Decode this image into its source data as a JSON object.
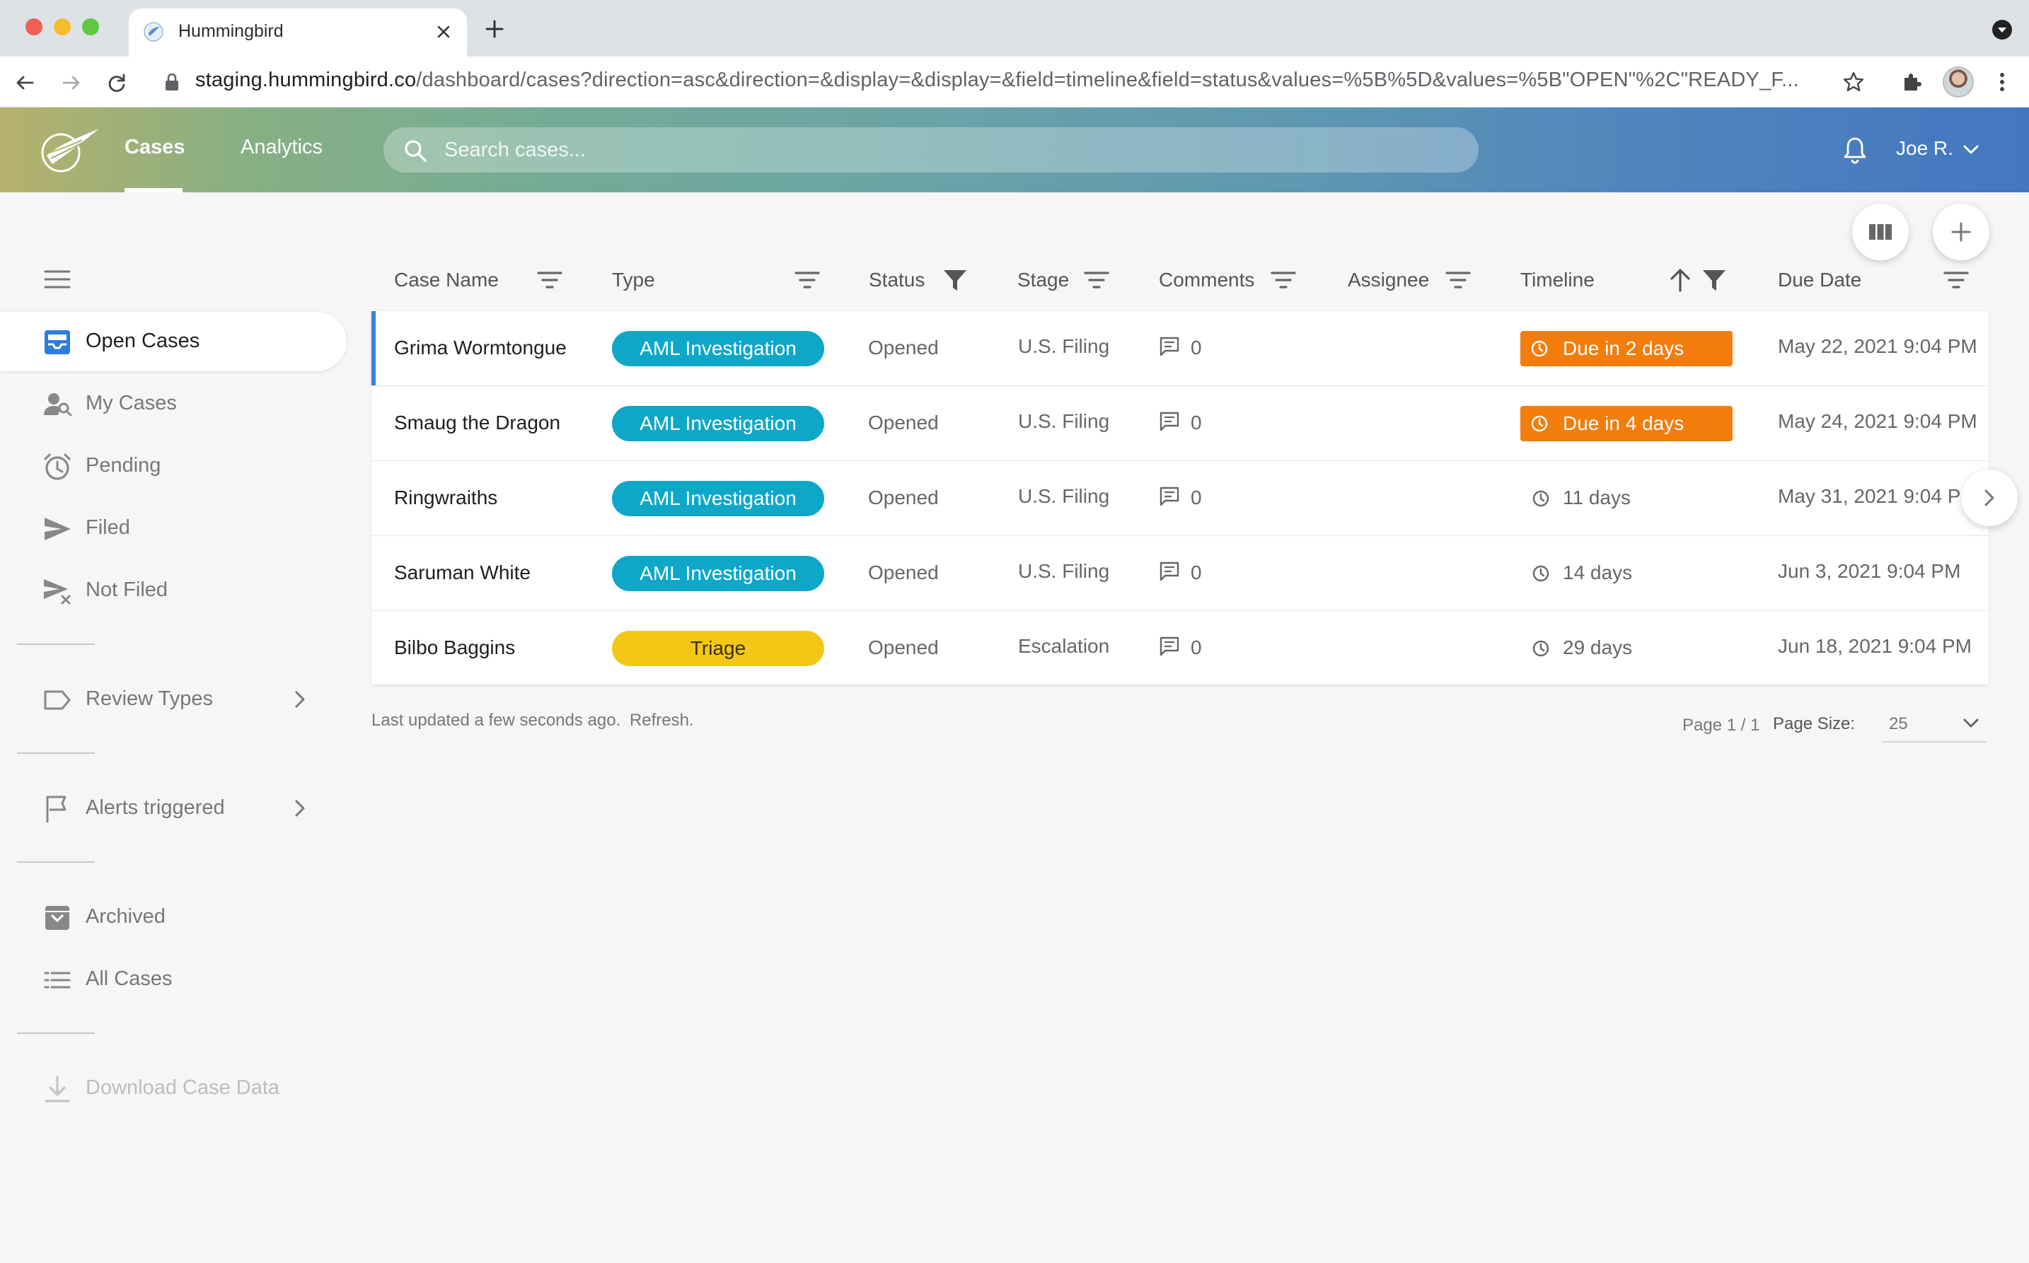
{
  "browser": {
    "tab_title": "Hummingbird",
    "url_host": "staging.hummingbird.co",
    "url_path": "/dashboard/cases?direction=asc&direction=&display=&display=&field=timeline&field=status&values=%5B%5D&values=%5B\"OPEN\"%2C\"READY_F..."
  },
  "header": {
    "nav_cases": "Cases",
    "nav_analytics": "Analytics",
    "search_placeholder": "Search cases...",
    "user_name": "Joe R.",
    "gradient_start": "#b6b16c",
    "gradient_end": "#4377c0"
  },
  "sidebar": {
    "open_cases": "Open Cases",
    "my_cases": "My Cases",
    "pending": "Pending",
    "filed": "Filed",
    "not_filed": "Not Filed",
    "review_types": "Review Types",
    "alerts_triggered": "Alerts triggered",
    "archived": "Archived",
    "all_cases": "All Cases",
    "download": "Download Case Data"
  },
  "table": {
    "columns": {
      "case_name": "Case Name",
      "type": "Type",
      "status": "Status",
      "stage": "Stage",
      "comments": "Comments",
      "assignee": "Assignee",
      "timeline": "Timeline",
      "due_date": "Due Date"
    },
    "rows": [
      {
        "name": "Grima Wormtongue",
        "type": "AML Investigation",
        "status": "Opened",
        "stage": "U.S. Filing",
        "comments": "0",
        "timeline": "Due in 2 days",
        "due": "May 22, 2021 9:04 PM"
      },
      {
        "name": "Smaug the Dragon",
        "type": "AML Investigation",
        "status": "Opened",
        "stage": "U.S. Filing",
        "comments": "0",
        "timeline": "Due in 4 days",
        "due": "May 24, 2021 9:04 PM"
      },
      {
        "name": "Ringwraiths",
        "type": "AML Investigation",
        "status": "Opened",
        "stage": "U.S. Filing",
        "comments": "0",
        "timeline": "11 days",
        "due": "May 31, 2021 9:04 PM"
      },
      {
        "name": "Saruman White",
        "type": "AML Investigation",
        "status": "Opened",
        "stage": "U.S. Filing",
        "comments": "0",
        "timeline": "14 days",
        "due": "Jun 3, 2021 9:04 PM"
      },
      {
        "name": "Bilbo Baggins",
        "type": "Triage",
        "status": "Opened",
        "stage": "Escalation",
        "comments": "0",
        "timeline": "29 days",
        "due": "Jun 18, 2021 9:04 PM"
      }
    ],
    "colors": {
      "aml": "#0fa7c8",
      "triage": "#f3c716",
      "due_soon": "#f27d0c",
      "selected_bar": "#3d7fe0"
    }
  },
  "footer": {
    "last_updated": "Last updated a few seconds ago.",
    "refresh": "Refresh.",
    "page": "Page 1 / 1",
    "page_size_label": "Page Size:",
    "page_size_value": "25"
  },
  "icons": {
    "filter": "filter-lines-icon",
    "filter_active": "funnel-icon",
    "sort": "arrow-up-icon",
    "comment": "comment-icon",
    "clock": "clock-icon"
  }
}
